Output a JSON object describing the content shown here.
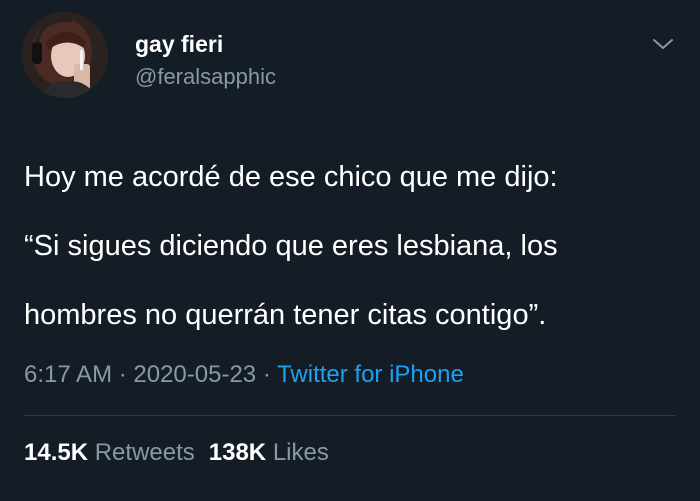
{
  "user": {
    "display_name": "gay fieri",
    "handle": "@feralsapphic",
    "avatar_icon": "user-avatar-photo"
  },
  "menu_icon": "chevron-down-icon",
  "tweet": {
    "lines": [
      "Hoy me acordé de ese chico que me dijo:",
      "“Si sigues diciendo que eres lesbiana, los",
      "hombres no querrán tener citas contigo”."
    ]
  },
  "meta": {
    "time": "6:17 AM",
    "separator1": " · ",
    "date": "2020-05-23",
    "separator2": " · ",
    "source": "Twitter for iPhone"
  },
  "stats": {
    "retweets_count": "14.5K",
    "retweets_label": "Retweets",
    "likes_count": "138K",
    "likes_label": "Likes"
  },
  "colors": {
    "background": "#141d26",
    "secondary_text": "#8899a6",
    "link": "#1da1f2"
  }
}
